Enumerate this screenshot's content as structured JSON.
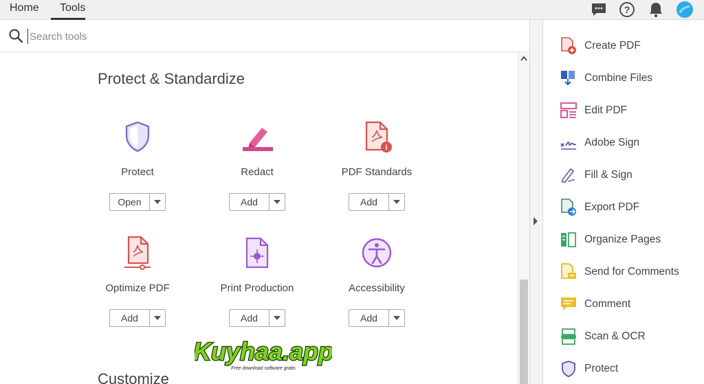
{
  "tabs": [
    {
      "label": "Home"
    },
    {
      "label": "Tools"
    }
  ],
  "search": {
    "placeholder": "Search tools"
  },
  "sections": [
    {
      "title": "Protect & Standardize"
    },
    {
      "title": "Customize"
    }
  ],
  "tools": [
    {
      "name": "Protect",
      "button": "Open",
      "icon": "shield-icon"
    },
    {
      "name": "Redact",
      "button": "Add",
      "icon": "redact-marker-icon"
    },
    {
      "name": "PDF Standards",
      "button": "Add",
      "icon": "pdf-standards-icon"
    },
    {
      "name": "Optimize PDF",
      "button": "Add",
      "icon": "optimize-pdf-icon"
    },
    {
      "name": "Print Production",
      "button": "Add",
      "icon": "print-production-icon"
    },
    {
      "name": "Accessibility",
      "button": "Add",
      "icon": "accessibility-icon"
    }
  ],
  "right_panel": [
    {
      "label": "Create PDF",
      "icon": "create-pdf-icon"
    },
    {
      "label": "Combine Files",
      "icon": "combine-files-icon"
    },
    {
      "label": "Edit PDF",
      "icon": "edit-pdf-icon"
    },
    {
      "label": "Adobe Sign",
      "icon": "adobe-sign-icon"
    },
    {
      "label": "Fill & Sign",
      "icon": "fill-sign-icon"
    },
    {
      "label": "Export PDF",
      "icon": "export-pdf-icon"
    },
    {
      "label": "Organize Pages",
      "icon": "organize-pages-icon"
    },
    {
      "label": "Send for Comments",
      "icon": "send-comments-icon"
    },
    {
      "label": "Comment",
      "icon": "comment-icon"
    },
    {
      "label": "Scan & OCR",
      "icon": "scan-ocr-icon"
    },
    {
      "label": "Protect",
      "icon": "shield-icon"
    }
  ],
  "watermark": {
    "text": "Kuyhaa.app",
    "tagline": "Free download software gratis"
  },
  "colors": {
    "red": "#d9534f",
    "purple": "#9b59d0",
    "pink": "#d24a8c",
    "blue": "#2d7fd0",
    "green": "#3ca864",
    "yellow": "#e8c22a",
    "indigo": "#5a4fb0"
  }
}
